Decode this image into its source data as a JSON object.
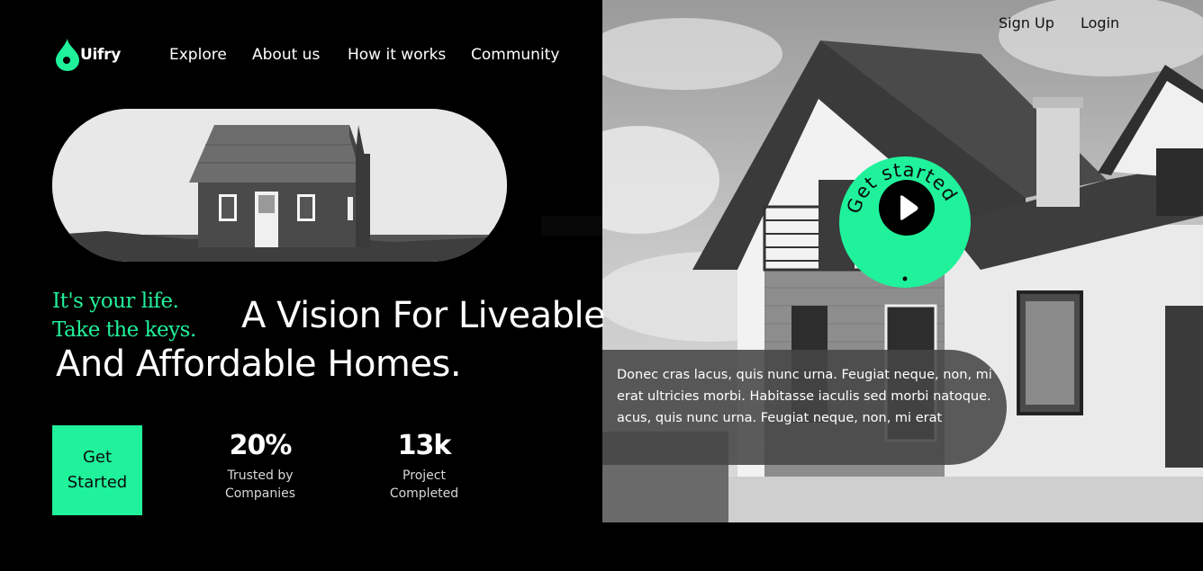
{
  "brand": {
    "name": "Uifry",
    "accent": "#1ff29b"
  },
  "nav": {
    "items": [
      {
        "label": "Explore"
      },
      {
        "label": "About us"
      },
      {
        "label": "How it works"
      },
      {
        "label": "Community"
      }
    ],
    "signup_label": "Sign Up",
    "login_label": "Login"
  },
  "hero": {
    "tagline_line1": "It's your life.",
    "tagline_line2": "Take the keys.",
    "headline_line1": "A Vision For Liveable",
    "headline_line2": "And Affordable Homes.",
    "cta_label": "Get Started",
    "badge_text": "Get started",
    "description": "Donec cras lacus, quis nunc urna. Feugiat neque, non, mi erat ultricies morbi. Habitasse iaculis sed morbi natoque. acus, quis nunc urna. Feugiat neque, non, mi erat"
  },
  "stats": [
    {
      "value": "20%",
      "label_line1": "Trusted by",
      "label_line2": "Companies"
    },
    {
      "value": "13k",
      "label_line1": "Project",
      "label_line2": "Completed"
    }
  ],
  "icons": {
    "logo": "drop-logo-icon",
    "play": "play-icon"
  }
}
